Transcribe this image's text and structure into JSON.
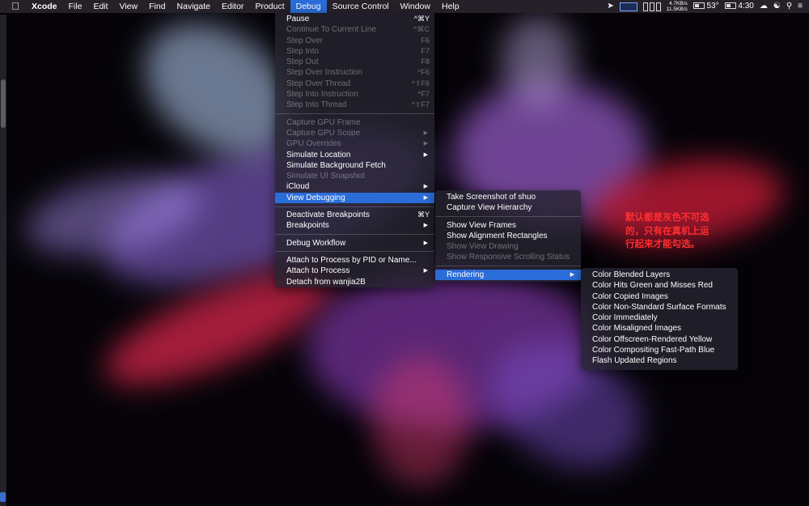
{
  "menubar": {
    "app": "Xcode",
    "menus": [
      "File",
      "Edit",
      "View",
      "Find",
      "Navigate",
      "Editor",
      "Product",
      "Debug",
      "Source Control",
      "Window",
      "Help"
    ],
    "active_menu": "Debug",
    "status": {
      "net_up": "4.7KB/s",
      "net_down": "11.5KB/s",
      "temperature": "53°",
      "time": "4:30"
    }
  },
  "debug_menu": [
    {
      "label": "Pause",
      "shortcut": "^⌘Y",
      "enabled": true
    },
    {
      "label": "Continue To Current Line",
      "shortcut": "^⌘C",
      "enabled": false
    },
    {
      "label": "Step Over",
      "shortcut": "F6",
      "enabled": false
    },
    {
      "label": "Step Into",
      "shortcut": "F7",
      "enabled": false
    },
    {
      "label": "Step Out",
      "shortcut": "F8",
      "enabled": false
    },
    {
      "label": "Step Over Instruction",
      "shortcut": "^F6",
      "enabled": false
    },
    {
      "label": "Step Over Thread",
      "shortcut": "^⇧F6",
      "enabled": false
    },
    {
      "label": "Step Into Instruction",
      "shortcut": "^F7",
      "enabled": false
    },
    {
      "label": "Step Into Thread",
      "shortcut": "^⇧F7",
      "enabled": false
    },
    {
      "separator": true
    },
    {
      "label": "Capture GPU Frame",
      "shortcut": "",
      "enabled": false
    },
    {
      "label": "Capture GPU Scope",
      "shortcut": "",
      "enabled": false,
      "submenu": true
    },
    {
      "label": "GPU Overrides",
      "shortcut": "",
      "enabled": false,
      "submenu": true
    },
    {
      "label": "Simulate Location",
      "shortcut": "",
      "enabled": true,
      "submenu": true
    },
    {
      "label": "Simulate Background Fetch",
      "shortcut": "",
      "enabled": true
    },
    {
      "label": "Simulate UI Snapshot",
      "shortcut": "",
      "enabled": false
    },
    {
      "label": "iCloud",
      "shortcut": "",
      "enabled": true,
      "submenu": true
    },
    {
      "label": "View Debugging",
      "shortcut": "",
      "enabled": true,
      "submenu": true,
      "highlight": true
    },
    {
      "separator": true
    },
    {
      "label": "Deactivate Breakpoints",
      "shortcut": "⌘Y",
      "enabled": true
    },
    {
      "label": "Breakpoints",
      "shortcut": "",
      "enabled": true,
      "submenu": true
    },
    {
      "separator": true
    },
    {
      "label": "Debug Workflow",
      "shortcut": "",
      "enabled": true,
      "submenu": true
    },
    {
      "separator": true
    },
    {
      "label": "Attach to Process by PID or Name...",
      "shortcut": "",
      "enabled": true
    },
    {
      "label": "Attach to Process",
      "shortcut": "",
      "enabled": true,
      "submenu": true
    },
    {
      "label": "Detach from wanjia2B",
      "shortcut": "",
      "enabled": true
    }
  ],
  "view_debugging_menu": [
    {
      "label": "Take Screenshot of shuo",
      "enabled": true
    },
    {
      "label": "Capture View Hierarchy",
      "enabled": true
    },
    {
      "separator": true
    },
    {
      "label": "Show View Frames",
      "enabled": true
    },
    {
      "label": "Show Alignment Rectangles",
      "enabled": true
    },
    {
      "label": "Show View Drawing",
      "enabled": false
    },
    {
      "label": "Show Responsive Scrolling Status",
      "enabled": false
    },
    {
      "separator": true
    },
    {
      "label": "Rendering",
      "enabled": true,
      "submenu": true,
      "highlight": true
    }
  ],
  "rendering_menu": [
    {
      "label": "Color Blended Layers",
      "enabled": true
    },
    {
      "label": "Color Hits Green and Misses Red",
      "enabled": true
    },
    {
      "label": "Color Copied Images",
      "enabled": true
    },
    {
      "label": "Color Non-Standard Surface Formats",
      "enabled": true
    },
    {
      "label": "Color Immediately",
      "enabled": true
    },
    {
      "label": "Color Misaligned Images",
      "enabled": true
    },
    {
      "label": "Color Offscreen-Rendered Yellow",
      "enabled": true
    },
    {
      "label": "Color Compositing Fast-Path Blue",
      "enabled": true
    },
    {
      "label": "Flash Updated Regions",
      "enabled": true
    }
  ],
  "annotation": "默认都是灰色不可选的，只有在真机上运行起来才能勾选。",
  "colors": {
    "highlight": "#2a6cd8",
    "annotation": "#ff2f2f",
    "menubar": "#262028"
  }
}
